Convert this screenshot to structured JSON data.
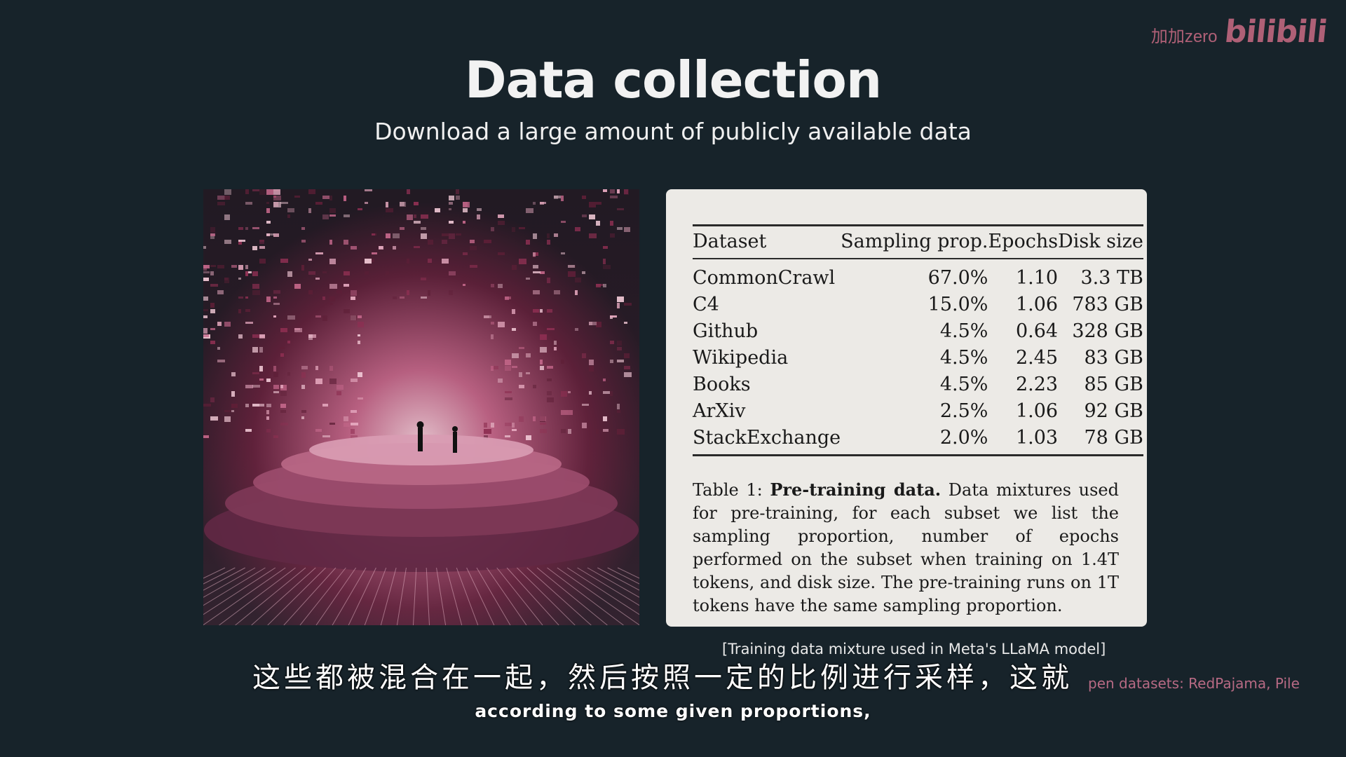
{
  "watermark": {
    "user": "加加zero",
    "brand": "bilibili"
  },
  "slide": {
    "title": "Data collection",
    "subtitle": "Download a large amount of publicly available data"
  },
  "table": {
    "headers": [
      "Dataset",
      "Sampling prop.",
      "Epochs",
      "Disk size"
    ],
    "rows": [
      [
        "CommonCrawl",
        "67.0%",
        "1.10",
        "3.3 TB"
      ],
      [
        "C4",
        "15.0%",
        "1.06",
        "783 GB"
      ],
      [
        "Github",
        "4.5%",
        "0.64",
        "328 GB"
      ],
      [
        "Wikipedia",
        "4.5%",
        "2.45",
        "83 GB"
      ],
      [
        "Books",
        "4.5%",
        "2.23",
        "85 GB"
      ],
      [
        "ArXiv",
        "2.5%",
        "1.06",
        "92 GB"
      ],
      [
        "StackExchange",
        "2.0%",
        "1.03",
        "78 GB"
      ]
    ],
    "caption_prefix": "Table 1: ",
    "caption_bold": "Pre-training data.",
    "caption_text": " Data mixtures used for pre-training, for each subset we list the sampling proportion, number of epochs performed on the subset when training on 1.4T tokens, and disk size. The pre-training runs on 1T tokens have the same sampling proportion."
  },
  "source_note": "[Training data mixture used in Meta's LLaMA model]",
  "side_note": "pen datasets: RedPajama, Pile",
  "subtitles": {
    "zh": "这些都被混合在一起，然后按照一定的比例进行采样，这就",
    "en": "according to some given proportions,"
  },
  "colors": {
    "background": "#17232a",
    "card": "#eceae6",
    "accent": "#c0677f",
    "art_magenta": "#8e2f52"
  }
}
